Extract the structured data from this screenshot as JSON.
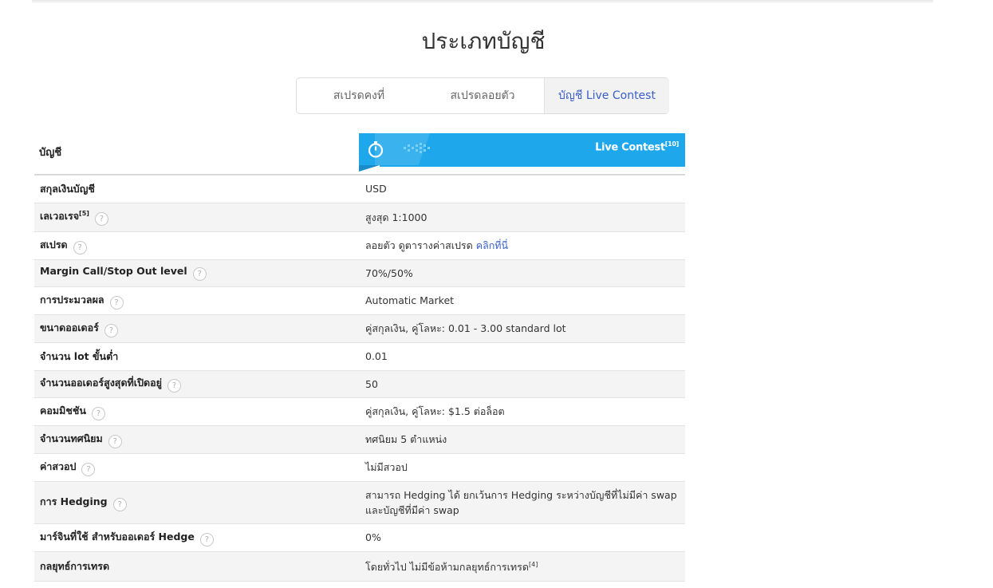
{
  "page": {
    "title": "ประเภทบัญชี"
  },
  "tabs": [
    {
      "label": "สเปรดคงที่",
      "active": false
    },
    {
      "label": "สเปรดลอยตัว",
      "active": false
    },
    {
      "label": "บัญชี Live Contest",
      "active": true
    }
  ],
  "header": {
    "label": "บัญชี",
    "account_name": "Live Contest",
    "account_ref": "[10]",
    "icons": [
      "stopwatch-icon",
      "dots-icon"
    ],
    "banner_color": "#1fa7ec"
  },
  "rows": [
    {
      "label": "สกุลเงินบัญชี",
      "sup": "",
      "help": false,
      "value": "USD"
    },
    {
      "label": "เลเวอเรจ",
      "sup": "[5]",
      "help": true,
      "value": "สูงสุด 1:1000"
    },
    {
      "label": "สเปรด",
      "sup": "",
      "help": true,
      "value": "ลอยตัว ดูตารางค่าสเปรด ",
      "link": "คลิกที่นี่"
    },
    {
      "label": "Margin Call/Stop Out level",
      "sup": "",
      "help": true,
      "value": "70%/50%"
    },
    {
      "label": "การประมวลผล",
      "sup": "",
      "help": true,
      "value": "Automatic Market"
    },
    {
      "label": "ขนาดออเดอร์",
      "sup": "",
      "help": true,
      "value": "คู่สกุลเงิน, คู่โลหะ: 0.01 - 3.00 standard lot"
    },
    {
      "label": "จำนวน lot ขั้นต่ำ",
      "sup": "",
      "help": false,
      "value": "0.01"
    },
    {
      "label": "จำนวนออเดอร์สูงสุดที่เปิดอยู่",
      "sup": "",
      "help": true,
      "value": "50"
    },
    {
      "label": "คอมมิชชัน",
      "sup": "",
      "help": true,
      "value": "คู่สกุลเงิน, คู่โลหะ: $1.5 ต่อล็อต"
    },
    {
      "label": "จำนวนทศนิยม",
      "sup": "",
      "help": true,
      "value": "ทศนิยม 5 ตำแหน่ง"
    },
    {
      "label": "ค่าสวอป",
      "sup": "",
      "help": true,
      "value": "ไม่มีสวอป"
    },
    {
      "label": "การ Hedging",
      "sup": "",
      "help": true,
      "value": "สามารถ Hedging ได้ ยกเว้นการ Hedging ระหว่างบัญชีที่ไม่มีค่า swap และบัญชีที่มีค่า swap"
    },
    {
      "label": "มาร์จินที่ใช้ สำหรับออเดอร์ Hedge",
      "sup": "",
      "help": true,
      "value": "0%"
    },
    {
      "label": "กลยุทธ์การเทรด",
      "sup": "",
      "help": false,
      "value": "โดยทั่วไป ไม่มีข้อห้ามกลยุทธ์การเทรด",
      "value_sup": "[4]"
    }
  ],
  "help_glyph": "?"
}
